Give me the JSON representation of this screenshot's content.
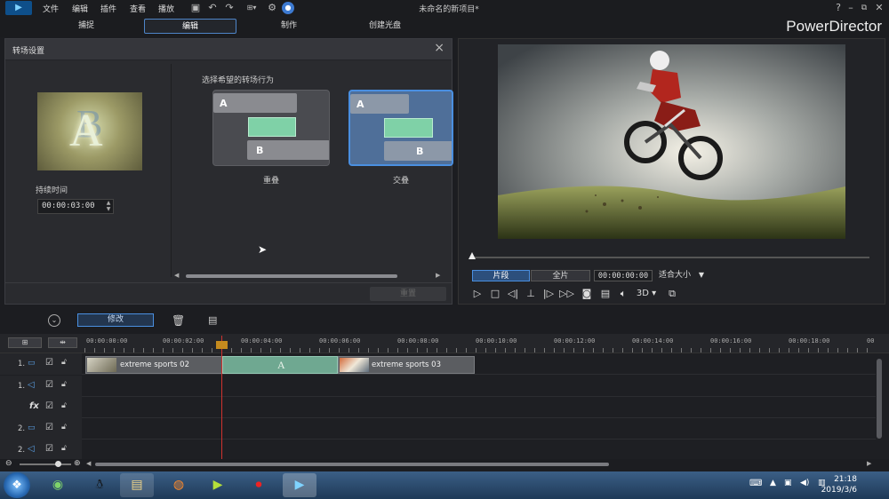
{
  "app": {
    "title": "未命名的新项目*",
    "brand": "PowerDirector"
  },
  "menu": [
    "文件",
    "编辑",
    "插件",
    "查看",
    "播放"
  ],
  "titlebar_icons": [
    "save-icon",
    "undo-icon",
    "redo-icon",
    "display-icon",
    "settings-icon",
    "account-icon",
    "help-icon",
    "minimize-icon",
    "restore-icon",
    "close-icon"
  ],
  "modes": [
    {
      "label": "捕捉",
      "active": false
    },
    {
      "label": "编辑",
      "active": true
    },
    {
      "label": "制作",
      "active": false
    },
    {
      "label": "创建光盘",
      "active": false
    }
  ],
  "transition_panel": {
    "title": "转场设置",
    "duration_label": "持续时间",
    "duration_value": "00:00:03:00",
    "behavior_label": "选择希望的转场行为",
    "options": [
      {
        "name": "重叠",
        "a": "A",
        "b": "B",
        "selected": false
      },
      {
        "name": "交叠",
        "a": "A",
        "b": "B",
        "selected": true
      }
    ],
    "reset_label": "重置"
  },
  "preview": {
    "clip_tab": "片段",
    "full_tab": "全片",
    "timecode": "00:00:00:00",
    "fit": "适合大小",
    "mode_3d": "3D",
    "playback_position": 0.0
  },
  "toolbar": {
    "modify_label": "修改"
  },
  "timeline": {
    "ruler_labels": [
      "00:00:00:00",
      "00:00:02:00",
      "00:00:04:00",
      "00:00:06:00",
      "00:00:08:00",
      "00:00:10:00",
      "00:00:12:00",
      "00:00:14:00",
      "00:00:16:00",
      "00:00:18:00",
      "00"
    ],
    "tracks": [
      {
        "name": "1.",
        "type": "video"
      },
      {
        "name": "1.",
        "type": "audio"
      },
      {
        "name": "fx",
        "type": "effect"
      },
      {
        "name": "2.",
        "type": "video"
      },
      {
        "name": "2.",
        "type": "audio"
      }
    ],
    "clips": [
      {
        "label": "extreme sports 02"
      },
      {
        "label": "extreme sports 03"
      }
    ],
    "transition_glyph": "A"
  },
  "taskbar": {
    "time": "21:18",
    "date": "2019/3/6"
  },
  "colors": {
    "accent": "#4a8fe0",
    "transition": "#7fd1a7",
    "playhead": "#d0322e"
  }
}
